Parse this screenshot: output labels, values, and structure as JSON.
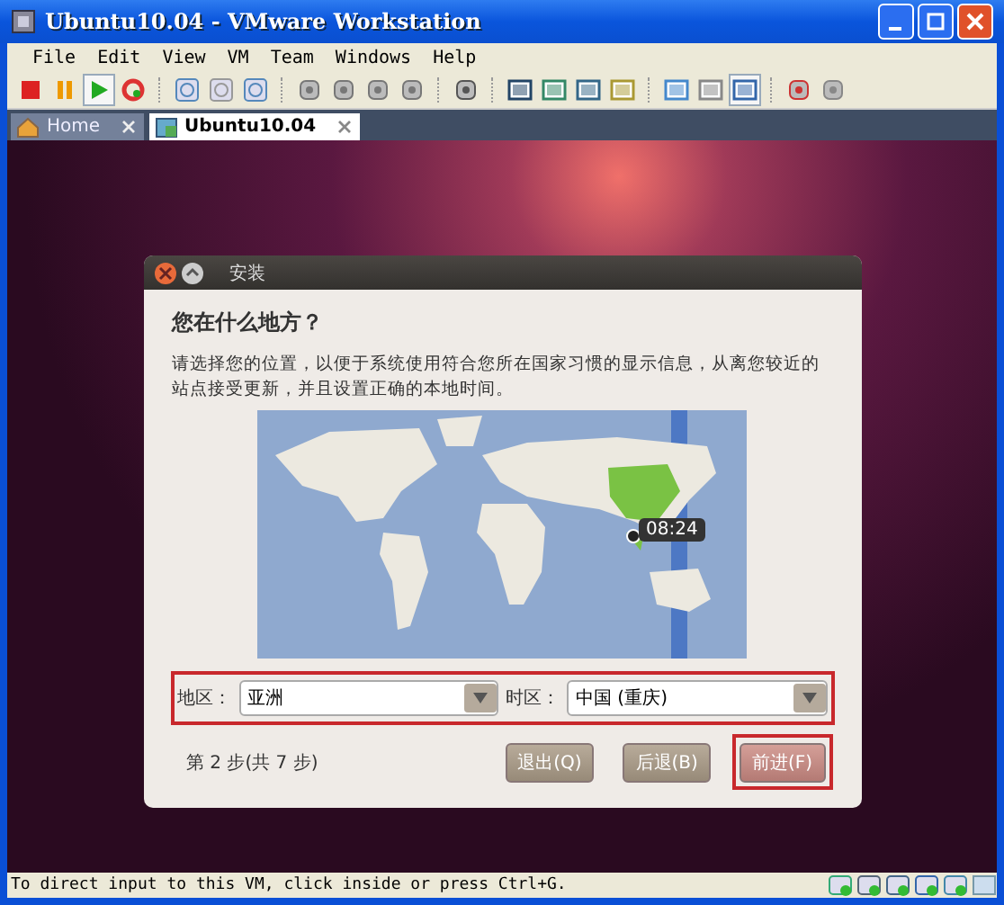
{
  "window": {
    "title": "Ubuntu10.04 - VMware Workstation"
  },
  "menu": [
    "File",
    "Edit",
    "View",
    "VM",
    "Team",
    "Windows",
    "Help"
  ],
  "tabs": [
    {
      "label": "Home",
      "selected": false
    },
    {
      "label": "Ubuntu10.04",
      "selected": true
    }
  ],
  "dialog": {
    "title": "安装",
    "heading": "您在什么地方？",
    "description": "请选择您的位置，以便于系统使用符合您所在国家习惯的显示信息，从离您较近的站点接受更新，并且设置正确的本地时间。",
    "map_time": "08:24",
    "region": {
      "label": "地区：",
      "value": "亚洲"
    },
    "timezone": {
      "label": "时区：",
      "value": "中国 (重庆)"
    },
    "step": "第 2 步(共 7 步)",
    "buttons": [
      {
        "label": "退出(Q)",
        "highlighted": false
      },
      {
        "label": "后退(B)",
        "highlighted": false
      },
      {
        "label": "前进(F)",
        "highlighted": true
      }
    ]
  },
  "status_bar": "To direct input to this VM, click inside or press Ctrl+G."
}
